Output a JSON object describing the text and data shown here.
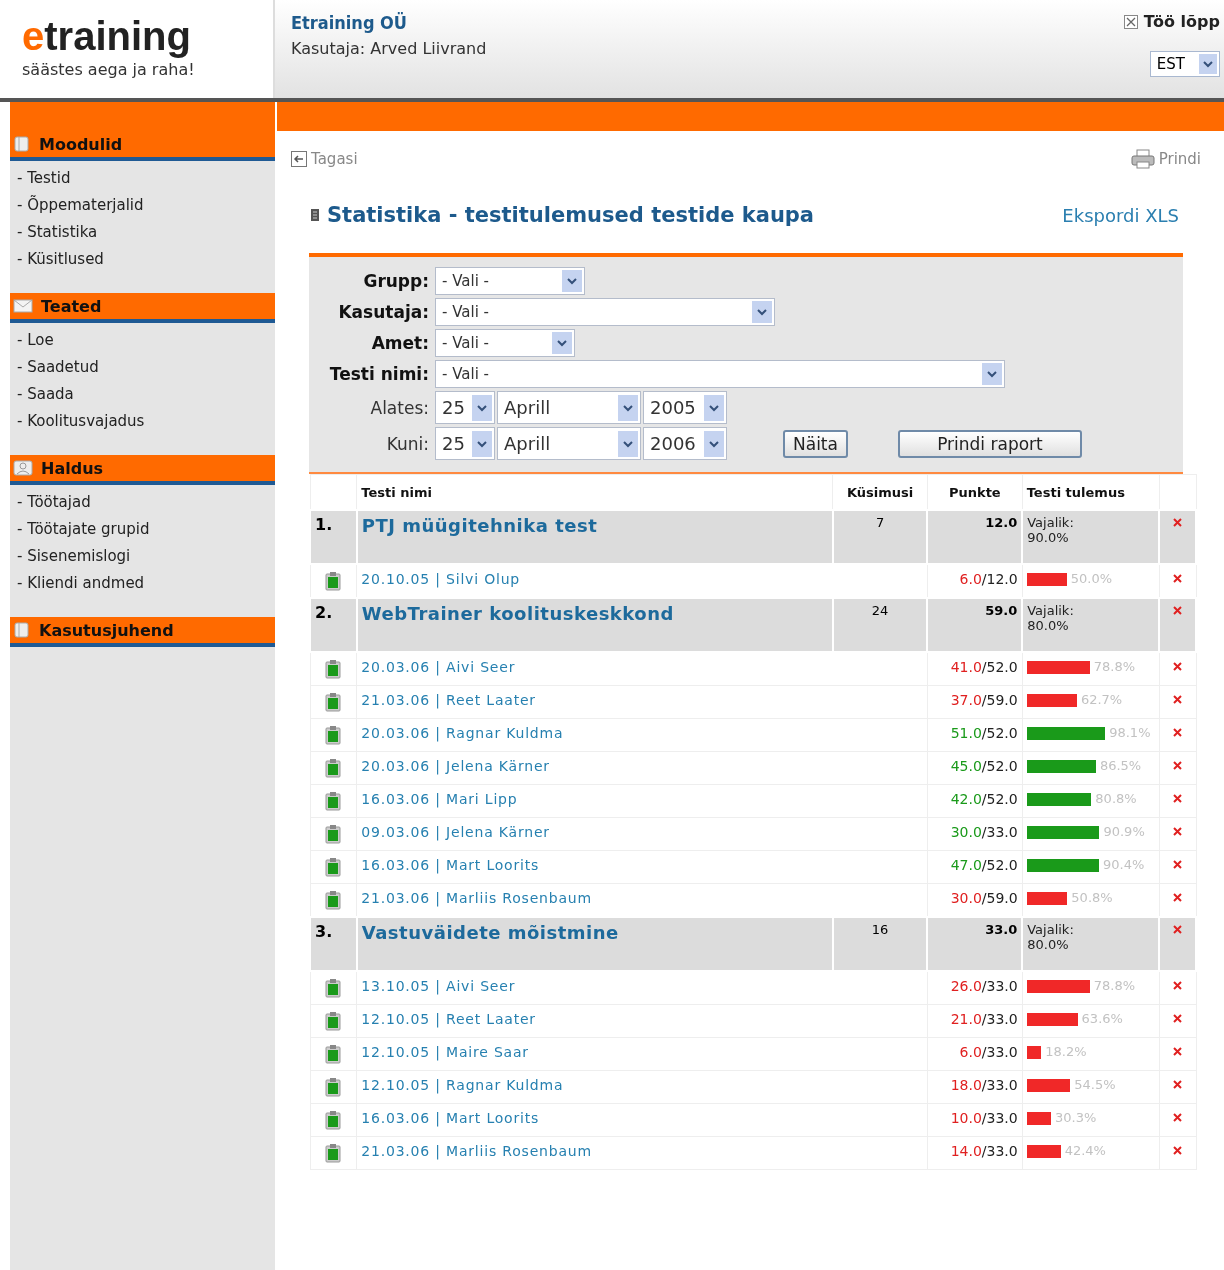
{
  "header": {
    "logo": "etraining",
    "tagline": "säästes aega ja raha!",
    "company": "Etraining OÜ",
    "user": "Kasutaja: Arved Liivrand",
    "logout": "Töö lõpp",
    "language": "EST"
  },
  "sidebar": [
    {
      "title": "Moodulid",
      "kind": "book",
      "items": [
        "- Testid",
        "- Õppematerjalid",
        "- Statistika",
        "- Küsitlused"
      ]
    },
    {
      "title": "Teated",
      "kind": "mail",
      "items": [
        "- Loe",
        "- Saadetud",
        "- Saada",
        "- Koolitusvajadus"
      ]
    },
    {
      "title": "Haldus",
      "kind": "user",
      "items": [
        "- Töötajad",
        "- Töötajate grupid",
        "- Sisenemislogi",
        "- Kliendi andmed"
      ]
    },
    {
      "title": "Kasutusjuhend",
      "kind": "book"
    }
  ],
  "toolbar": {
    "back": "Tagasi",
    "print": "Prindi"
  },
  "page_title": "Statistika - testitulemused testide kaupa",
  "export": "Ekspordi XLS",
  "filters": [
    {
      "label": "Grupp:",
      "value": "- Vali -",
      "bold": true
    },
    {
      "label": "Kasutaja:",
      "value": "- Vali -",
      "bold": true
    },
    {
      "label": "Amet:",
      "value": "- Vali -",
      "bold": true
    },
    {
      "label": "Testi nimi:",
      "value": "- Vali -",
      "bold": true
    }
  ],
  "date_filters": [
    {
      "label": "Alates:",
      "day": "25",
      "month": "Aprill",
      "year": "2005"
    },
    {
      "label": "Kuni:",
      "day": "25",
      "month": "Aprill",
      "year": "2006"
    }
  ],
  "buttons": [
    "Näita",
    "Prindi raport"
  ],
  "table": {
    "columns": [
      "Testi nimi",
      "Küsimusi",
      "Punkte",
      "Testi tulemus"
    ],
    "tests": [
      {
        "number": "1.",
        "name": "PTJ müügitehnika test",
        "questions": "7",
        "points": "12.0",
        "required": "Vajalik: 90.0%",
        "results": [
          {
            "entry": "20.10.05 | Silvi Olup",
            "earned": "6.0",
            "total": "/12.0",
            "passed": false,
            "percent": "50.0%"
          }
        ]
      },
      {
        "number": "2.",
        "name": "WebTrainer koolituskeskkond",
        "questions": "24",
        "points": "59.0",
        "required": "Vajalik: 80.0%",
        "results": [
          {
            "entry": "20.03.06 | Aivi Seer",
            "earned": "41.0",
            "total": "/52.0",
            "passed": false,
            "percent": "78.8%"
          },
          {
            "entry": "21.03.06 | Reet Laater",
            "earned": "37.0",
            "total": "/59.0",
            "passed": false,
            "percent": "62.7%"
          },
          {
            "entry": "20.03.06 | Ragnar Kuldma",
            "earned": "51.0",
            "total": "/52.0",
            "passed": true,
            "percent": "98.1%"
          },
          {
            "entry": "20.03.06 | Jelena Kärner",
            "earned": "45.0",
            "total": "/52.0",
            "passed": true,
            "percent": "86.5%"
          },
          {
            "entry": "16.03.06 | Mari Lipp",
            "earned": "42.0",
            "total": "/52.0",
            "passed": true,
            "percent": "80.8%"
          },
          {
            "entry": "09.03.06 | Jelena Kärner",
            "earned": "30.0",
            "total": "/33.0",
            "passed": true,
            "percent": "90.9%"
          },
          {
            "entry": "16.03.06 | Mart Loorits",
            "earned": "47.0",
            "total": "/52.0",
            "passed": true,
            "percent": "90.4%"
          },
          {
            "entry": "21.03.06 | Marliis Rosenbaum",
            "earned": "30.0",
            "total": "/59.0",
            "passed": false,
            "percent": "50.8%"
          }
        ]
      },
      {
        "number": "3.",
        "name": "Vastuväidete mõistmine",
        "questions": "16",
        "points": "33.0",
        "required": "Vajalik: 80.0%",
        "results": [
          {
            "entry": "13.10.05 | Aivi Seer",
            "earned": "26.0",
            "total": "/33.0",
            "passed": false,
            "percent": "78.8%"
          },
          {
            "entry": "12.10.05 | Reet Laater",
            "earned": "21.0",
            "total": "/33.0",
            "passed": false,
            "percent": "63.6%"
          },
          {
            "entry": "12.10.05 | Maire Saar",
            "earned": "6.0",
            "total": "/33.0",
            "passed": false,
            "percent": "18.2%"
          },
          {
            "entry": "12.10.05 | Ragnar Kuldma",
            "earned": "18.0",
            "total": "/33.0",
            "passed": false,
            "percent": "54.5%"
          },
          {
            "entry": "16.03.06 | Mart Loorits",
            "earned": "10.0",
            "total": "/33.0",
            "passed": false,
            "percent": "30.3%"
          },
          {
            "entry": "21.03.06 | Marliis Rosenbaum",
            "earned": "14.0",
            "total": "/33.0",
            "passed": false,
            "percent": "42.4%"
          }
        ]
      }
    ]
  }
}
